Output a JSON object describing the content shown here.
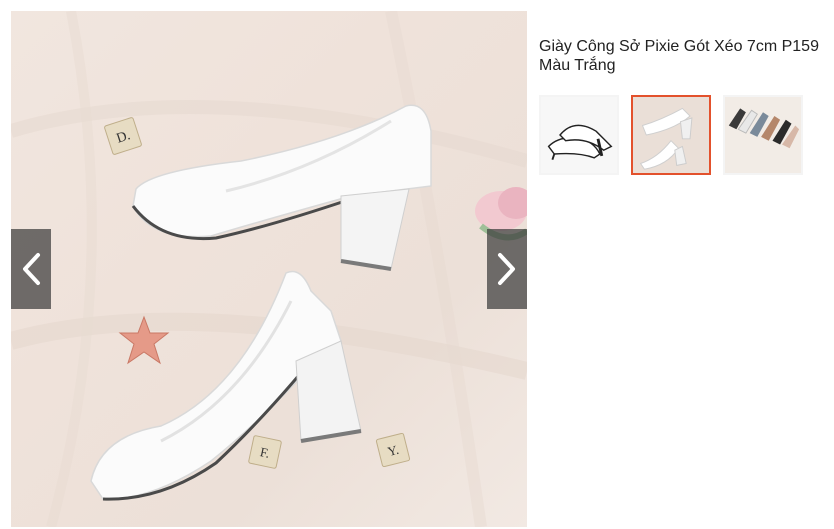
{
  "product": {
    "title": "Giày Công Sở Pixie Gót Xéo 7cm P159 Màu Trắng"
  },
  "gallery": {
    "prev_icon": "chevron-left-icon",
    "next_icon": "chevron-right-icon",
    "active_index": 1,
    "thumbnails": [
      {
        "name": "white-shoes-side-view"
      },
      {
        "name": "white-shoes-top-view"
      },
      {
        "name": "shoe-color-variants"
      }
    ],
    "props": {
      "tile_d": "D.",
      "tile_f": "F.",
      "tile_y": "Y."
    }
  },
  "colors": {
    "active_border": "#e3512c",
    "arrow_bg": "#3c3c3c"
  }
}
